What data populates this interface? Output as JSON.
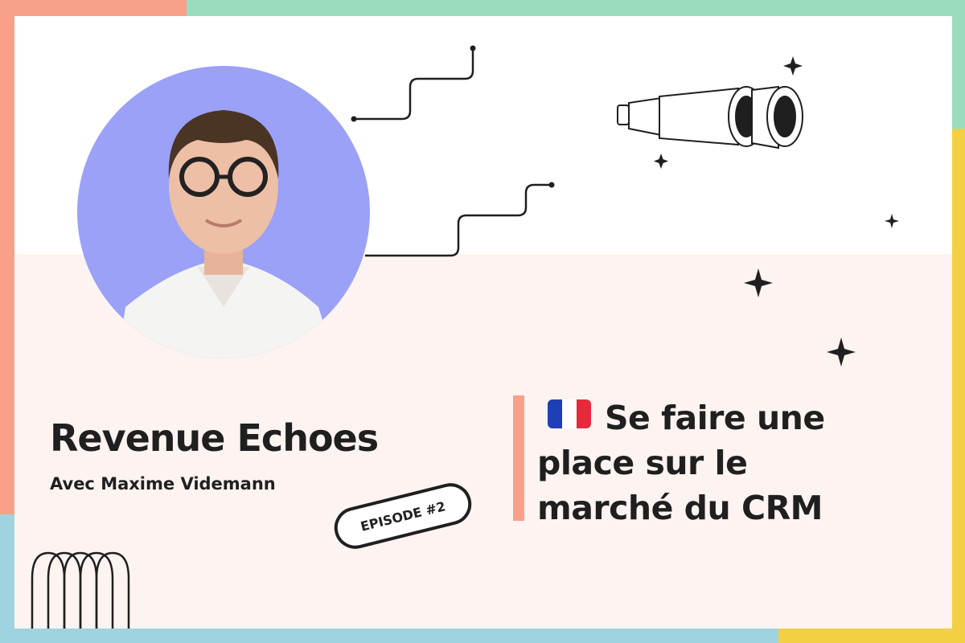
{
  "show": {
    "title": "Revenue Echoes",
    "subtitle": "Avec Maxime Videmann"
  },
  "episode": {
    "badge_label": "EPISODE #2",
    "title_lines": [
      "Se faire une",
      "place sur le",
      "marché du CRM"
    ],
    "language_flag_icon": "france-flag-icon"
  },
  "guest": {
    "photo_icon": "guest-portrait-photo"
  },
  "colors": {
    "frame_coral": "#f8a08a",
    "frame_mint": "#9adcbd",
    "frame_blue": "#9fd3e0",
    "frame_yellow": "#f2cf45",
    "avatar_background": "#9aa1f7",
    "accent_bar": "#f8a08a",
    "panel_bottom": "#fdf3f1",
    "ink": "#1f1f1f"
  },
  "icons": [
    "stairs-line-icon",
    "binoculars-icon",
    "sparkle-icon",
    "arches-icon"
  ]
}
